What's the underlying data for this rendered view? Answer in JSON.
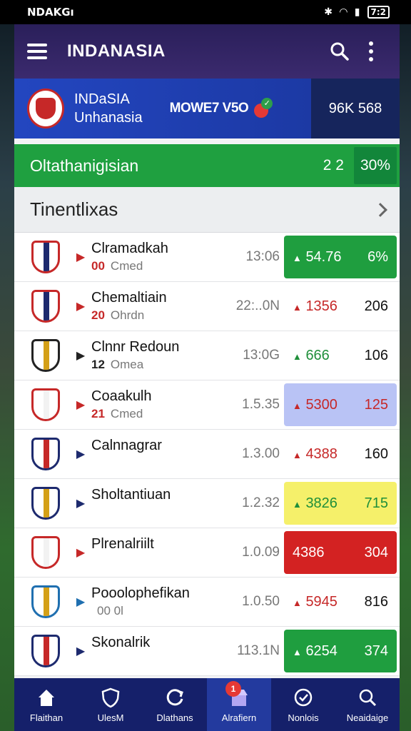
{
  "status_bar": {
    "left": "NDAKGı",
    "time": "7:2",
    "battery": ""
  },
  "app_bar": {
    "title": "INDANASIA",
    "menu_icon": "hamburger-icon",
    "search_icon": "search-icon",
    "more_icon": "more-vert-icon"
  },
  "hero": {
    "line1": "INDaSIA",
    "line2": "Unhanasia",
    "match": "MOWE7 V5O",
    "score": "96K 568",
    "colors": {
      "left": "#2346c0",
      "right": "#16255c"
    }
  },
  "promo": {
    "title": "Oltathanigisian",
    "count": "2 2",
    "percent": "30%",
    "color": "#1fa040"
  },
  "section": {
    "title": "Tinentlixas"
  },
  "matches": [
    {
      "name": "Clramadkah",
      "num": "00",
      "sub": "Cmed",
      "time": "13:06",
      "arrow": "up",
      "odd": "54.76",
      "pct": "6%",
      "bg": "#1f9e3f",
      "fg": "#ffffff",
      "crest": [
        "#c62828",
        "#1d2a6e"
      ]
    },
    {
      "name": "Chemaltiain",
      "num": "20",
      "sub": "Ohrdn",
      "time": "22:..0N",
      "arrow": "up",
      "odd": "1356",
      "pct": "206",
      "bg": "#ffffff",
      "fg": "#c62828",
      "crest": [
        "#c62828",
        "#1d2a6e"
      ]
    },
    {
      "name": "Clnnr Redoun",
      "num": "12",
      "sub": "Omea",
      "time": "13:0G",
      "arrow": "up",
      "odd": "666",
      "pct": "106",
      "bg": "#ffffff",
      "fg": "#1f8f3a",
      "crest": [
        "#222222",
        "#d4a017"
      ]
    },
    {
      "name": "Coaakulh",
      "num": "21",
      "sub": "Cmed",
      "time": "1.5.35",
      "arrow": "up",
      "odd": "5300",
      "pct": "125",
      "bg": "#b9c3f5",
      "fg": "#c62828",
      "crest": [
        "#c62828",
        "#f2f2f2"
      ]
    },
    {
      "name": "Calnnagrar",
      "num": "",
      "sub": "",
      "time": "1.3.00",
      "arrow": "up",
      "odd": "4388",
      "pct": "160",
      "bg": "#ffffff",
      "fg": "#c62828",
      "crest": [
        "#1d2a6e",
        "#c62828"
      ]
    },
    {
      "name": "Sholtantiuan",
      "num": "",
      "sub": "",
      "time": "1.2.32",
      "arrow": "up",
      "odd": "3826",
      "pct": "715",
      "bg": "#f5f06a",
      "fg": "#1f8f3a",
      "crest": [
        "#1d2a6e",
        "#d4a017"
      ]
    },
    {
      "name": "Plrenalriilt",
      "num": "",
      "sub": "",
      "time": "1.0.09",
      "arrow": "",
      "odd": "4386",
      "pct": "304",
      "bg": "#d32222",
      "fg": "#ffffff",
      "crest": [
        "#c62828",
        "#f2f2f2"
      ]
    },
    {
      "name": "Pooolophefikan",
      "num": "",
      "sub": "00 0l",
      "time": "1.0.50",
      "arrow": "up",
      "odd": "5945",
      "pct": "816",
      "bg": "#ffffff",
      "fg": "#c62828",
      "crest": [
        "#1f6fb0",
        "#d4a017"
      ]
    },
    {
      "name": "Skonalrik",
      "num": "",
      "sub": "",
      "time": "113.1N",
      "arrow": "up",
      "odd": "6254",
      "pct": "374",
      "bg": "#1f9e3f",
      "fg": "#ffffff",
      "crest": [
        "#1d2a6e",
        "#c62828"
      ]
    }
  ],
  "tabs": [
    {
      "label": "Flaithan",
      "icon": "home-icon"
    },
    {
      "label": "UlesM",
      "icon": "shield-icon"
    },
    {
      "label": "Dlathans",
      "icon": "refresh-icon"
    },
    {
      "label": "Alrafiern",
      "icon": "store-icon",
      "badge": "1"
    },
    {
      "label": "Nonlois",
      "icon": "verified-icon"
    },
    {
      "label": "Neaidaige",
      "icon": "search-doc-icon"
    }
  ]
}
